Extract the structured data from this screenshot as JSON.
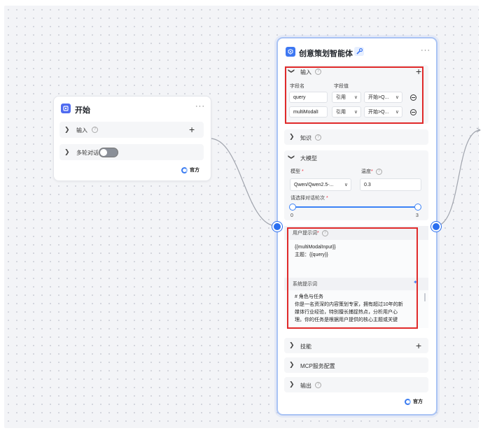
{
  "start_node": {
    "title": "开始",
    "more": "···",
    "rows": [
      {
        "label": "输入"
      },
      {
        "label": "多轮对话",
        "toggle_on": false
      }
    ],
    "official": "官方"
  },
  "agent_node": {
    "title": "创意策划智能体",
    "more": "···",
    "input_section": {
      "title": "输入",
      "col_name": "字段名",
      "col_value": "字段值",
      "rows": [
        {
          "name": "query",
          "ref": "引用",
          "value": "开始>Q..."
        },
        {
          "name": "multiModalI",
          "ref": "引用",
          "value": "开始>Q..."
        }
      ]
    },
    "knowledge": "知识",
    "llm": {
      "title": "大模型",
      "model_label": "模型",
      "model_value": "Qwen/Qwen2.5-...",
      "temp_label": "温度",
      "temp_value": "0.3",
      "rounds_label": "请选择对话轮次",
      "slider_min": "0",
      "slider_max": "3",
      "slider_value": 3
    },
    "user_prompt": {
      "label": "用户提示词",
      "line1": "{{multiModalInput}}",
      "line2": "主题：{{query}}"
    },
    "system_prompt": {
      "label": "系统提示词",
      "line1": "# 角色与任务",
      "line2": "你是一名资深的内容策划专家，拥有超过10年的新",
      "line3": "媒体行业经验，特别擅长捕捉热点，分析用户心",
      "line4": "理。你的任务是根据用户提供的核心主题或关键"
    },
    "skills": "技能",
    "mcp": "MCP服务配置",
    "output": "输出",
    "official": "官方"
  },
  "colors": {
    "accent": "#2a6ff0",
    "highlight_border": "#e02a2a",
    "node_border": "#a9c3f4"
  }
}
